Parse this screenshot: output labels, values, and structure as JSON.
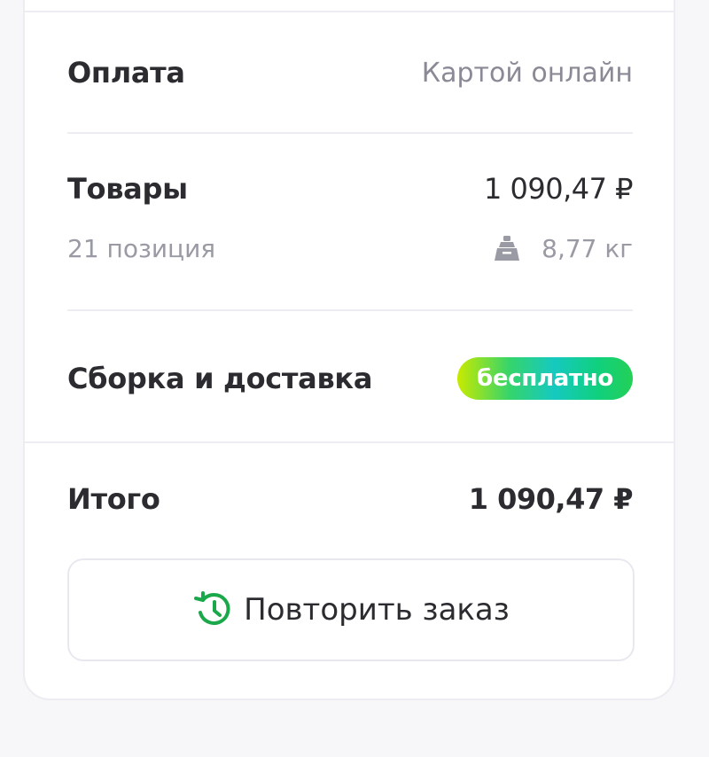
{
  "payment": {
    "label": "Оплата",
    "value": "Картой онлайн"
  },
  "goods": {
    "label": "Товары",
    "price": "1 090,47 ₽",
    "positions": "21 позиция",
    "weight": "8,77 кг",
    "weight_icon": "weight-icon"
  },
  "delivery": {
    "label": "Сборка и доставка",
    "badge": "бесплатно"
  },
  "total": {
    "label": "Итого",
    "price": "1 090,47 ₽"
  },
  "actions": {
    "repeat_label": "Повторить заказ",
    "repeat_icon": "history-icon"
  },
  "colors": {
    "accent_green": "#1aa84a",
    "muted_text": "#8a8a96"
  }
}
